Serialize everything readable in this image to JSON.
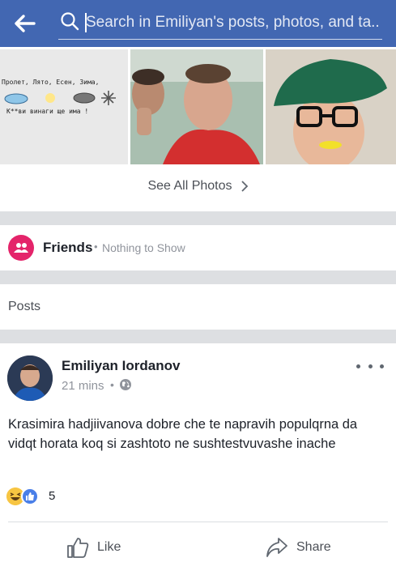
{
  "search": {
    "placeholder": "Search in Emiliyan's posts, photos, and ta..."
  },
  "photos": {
    "meme_line_1": "Пролет, Лято, Есен, Зима,",
    "meme_line_2": "К**ви винаги ще има !",
    "see_all_label": "See All Photos"
  },
  "friends": {
    "title": "Friends",
    "separator": "•",
    "status": "Nothing to Show"
  },
  "posts": {
    "title": "Posts"
  },
  "post": {
    "author": "Emiliyan Iordanov",
    "time": "21 mins",
    "separator": "•",
    "text": "Krasimira hadjiivanova dobre che te napravih populqrna da vidqt horata koq si zashtoto ne sushtestvuvashe inache",
    "reaction_count": "5",
    "like_label": "Like",
    "share_label": "Share"
  },
  "colors": {
    "brand": "#4267b2",
    "friends_badge": "#e4246a",
    "background": "#dddfe2",
    "secondary_text": "#90949c"
  }
}
